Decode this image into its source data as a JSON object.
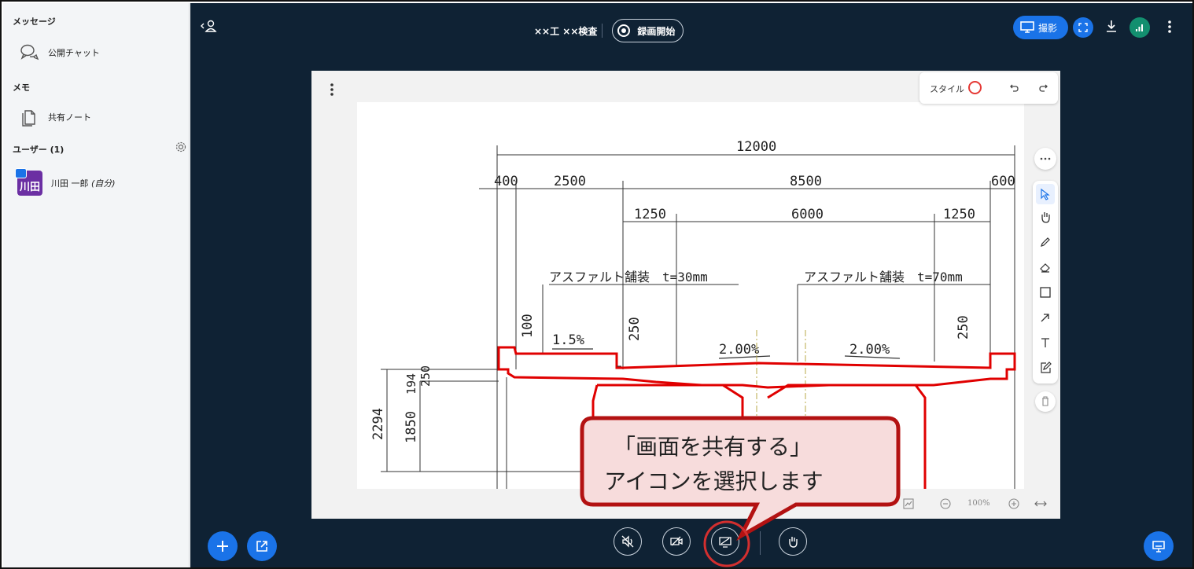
{
  "sidebar": {
    "messages_title": "メッセージ",
    "public_chat": "公開チャット",
    "memo_title": "メモ",
    "shared_note": "共有ノート",
    "users_title": "ユーザー (1)",
    "user_avatar_text": "川田",
    "user_name": "川田 一郎",
    "user_self": "(自分)"
  },
  "topbar": {
    "meeting_name": "××工 ××検査",
    "record_label": "録画開始",
    "camera_label": "撮影"
  },
  "whiteboard": {
    "style_label": "スタイル",
    "zoom_level": "100%",
    "style_color": "#e53935"
  },
  "drawing": {
    "dims_top": "12000",
    "dims_row2": [
      "400",
      "2500",
      "8500",
      "600"
    ],
    "dims_row3": [
      "1250",
      "6000",
      "1250"
    ],
    "pavement_left": "アスファルト舗装　t=30mm",
    "pavement_right": "アスファルト舗装　t=70mm",
    "slope_left": "1.5%",
    "slope_mid": "2.00%",
    "slope_right": "2.00%",
    "vertical_labels": [
      "100",
      "250",
      "250",
      "194",
      "250",
      "2294",
      "1850"
    ]
  },
  "callout": {
    "line1": "「画面を共有する」",
    "line2": "アイコンを選択します"
  },
  "icons": {
    "chat": "chat-bubbles-icon",
    "note": "document-icon",
    "gear": "gear-icon",
    "share_screen": "share-screen-icon",
    "mic": "microphone-muted-icon",
    "camera": "camera-off-icon",
    "hand": "raise-hand-icon"
  },
  "colors": {
    "main_bg": "#0f2234",
    "accent": "#1a73e8",
    "callout_fill": "#f7dcdc",
    "callout_border": "#b31212",
    "highlight_circle": "#d32f2f"
  }
}
